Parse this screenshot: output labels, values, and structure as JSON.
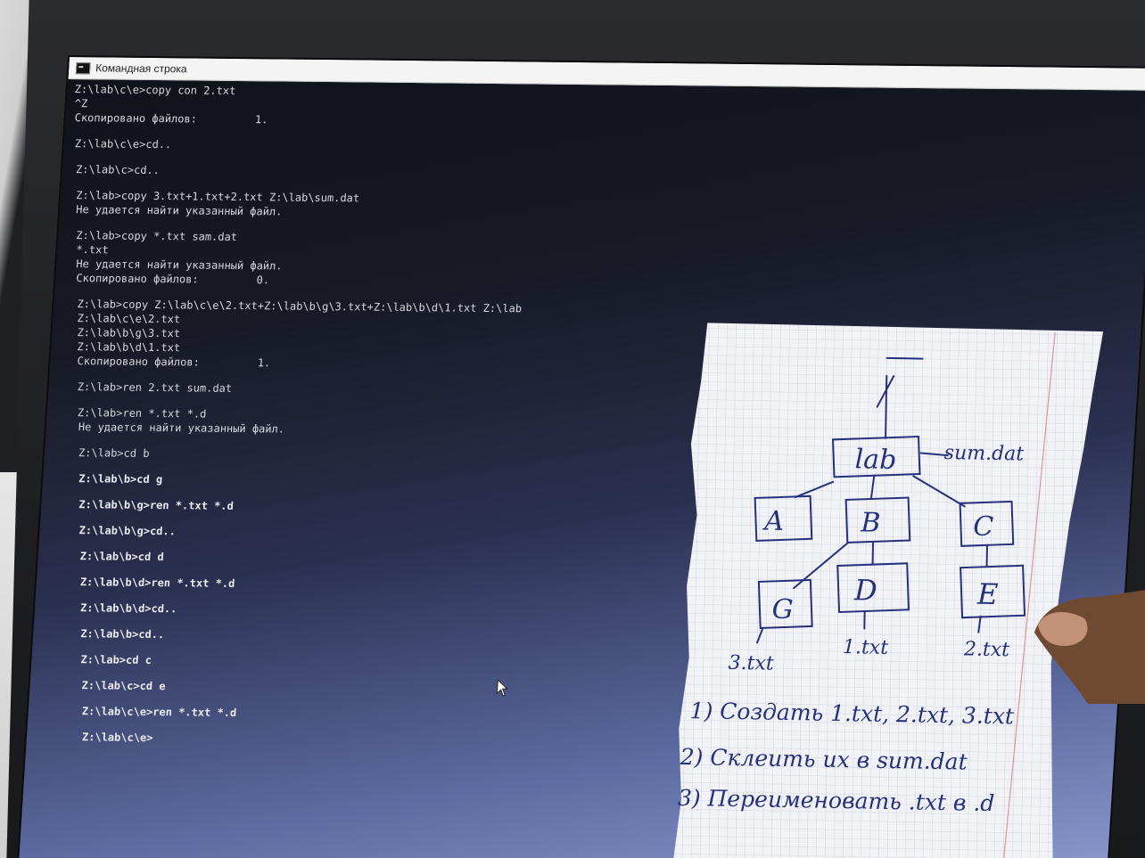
{
  "window": {
    "title": "Командная строка",
    "icon": "cmd-icon"
  },
  "console": {
    "lines": [
      "Z:\\lab\\c\\e>copy con 2.txt",
      "^Z",
      "Скопировано файлов:         1.",
      "",
      "Z:\\lab\\c\\e>cd..",
      "",
      "Z:\\lab\\c>cd..",
      "",
      "Z:\\lab>copy 3.txt+1.txt+2.txt Z:\\lab\\sum.dat",
      "Не удается найти указанный файл.",
      "",
      "Z:\\lab>copy *.txt sam.dat",
      "*.txt",
      "Не удается найти указанный файл.",
      "Скопировано файлов:         0.",
      "",
      "Z:\\lab>copy Z:\\lab\\c\\e\\2.txt+Z:\\lab\\b\\g\\3.txt+Z:\\lab\\b\\d\\1.txt Z:\\lab",
      "Z:\\lab\\c\\e\\2.txt",
      "Z:\\lab\\b\\g\\3.txt",
      "Z:\\lab\\b\\d\\1.txt",
      "Скопировано файлов:         1.",
      "",
      "Z:\\lab>ren 2.txt sum.dat",
      "",
      "Z:\\lab>ren *.txt *.d",
      "Не удается найти указанный файл.",
      "",
      "Z:\\lab>cd b",
      "",
      "Z:\\lab\\b>cd g",
      "",
      "Z:\\lab\\b\\g>ren *.txt *.d",
      "",
      "Z:\\lab\\b\\g>cd..",
      "",
      "Z:\\lab\\b>cd d",
      "",
      "Z:\\lab\\b\\d>ren *.txt *.d",
      "",
      "Z:\\lab\\b\\d>cd..",
      "",
      "Z:\\lab\\b>cd..",
      "",
      "Z:\\lab>cd c",
      "",
      "Z:\\lab\\c>cd e",
      "",
      "Z:\\lab\\c\\e>ren *.txt *.d",
      "",
      "Z:\\lab\\c\\e>"
    ]
  },
  "note": {
    "tree": {
      "root": "lab",
      "root_file": "sum.dat",
      "level1": [
        "A",
        "B",
        "C"
      ],
      "level2": [
        "G",
        "D",
        "E"
      ],
      "files": [
        "3.txt",
        "1.txt",
        "2.txt"
      ]
    },
    "tasks": [
      "1) Создать 1.txt, 2.txt, 3.txt",
      "2) Склеить их в sum.dat",
      "3) Переименовать .txt в .d"
    ]
  }
}
